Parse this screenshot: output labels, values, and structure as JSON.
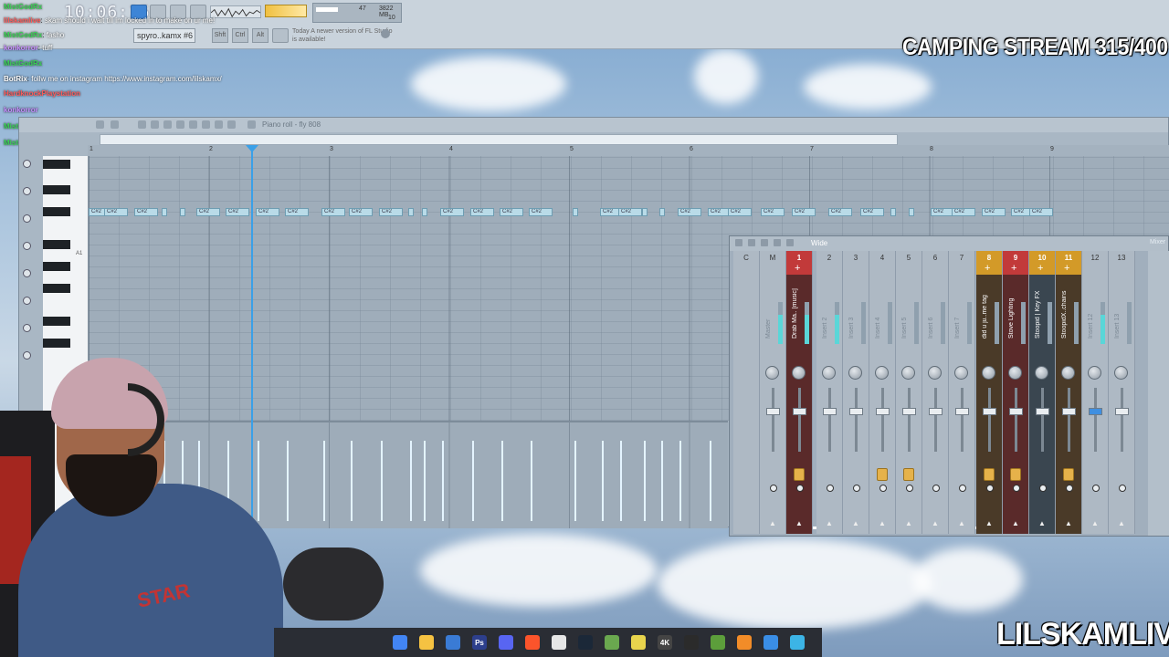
{
  "app": {
    "clock": "10:06:15",
    "cpu": {
      "v1": "47",
      "v2": "3822 MB",
      "v3": "10"
    },
    "preset": "spyro..kamx #6",
    "mode_buttons": [
      "Shft",
      "Ctrl",
      "Alt"
    ],
    "update_note": "Today  A newer version of FL Studio is available!"
  },
  "chat": [
    {
      "user": "MistGodRx",
      "message": "",
      "color": "#39d353"
    },
    {
      "user": "lilskamlive",
      "message": "skam should i wait till im locked in to make on ur me!",
      "color": "#ff5a5a"
    },
    {
      "user": "MistGodRx",
      "message": "fasho",
      "color": "#39d353"
    },
    {
      "user": "konkorror",
      "message": "tuff",
      "color": "#c68cff"
    },
    {
      "user": "MistGodRx",
      "message": "",
      "color": "#39d353"
    },
    {
      "user": "BotRix",
      "message": "follw me on instagram https://www.instagram.com/lilskamx/",
      "color": "#ffffff"
    },
    {
      "user": "HardknockPlaystation",
      "message": "",
      "color": "#ff5a5a"
    },
    {
      "user": "konkorror",
      "message": "",
      "color": "#c68cff"
    },
    {
      "user": "MistGodRx",
      "message": "",
      "color": "#39d353"
    },
    {
      "user": "MistGodRx",
      "message": "",
      "color": "#39d353"
    }
  ],
  "overlay": {
    "stream_title": "CAMPING STREAM 315/400",
    "brand": "LILSKAMLIVE",
    "hoodie_text": "STAR"
  },
  "piano_roll": {
    "title": "Piano roll - fly 808",
    "bars": [
      "1",
      "2",
      "3",
      "4",
      "5",
      "6",
      "7",
      "8",
      "9"
    ],
    "key_label": "A1",
    "note_label": "C#2",
    "note_count": 46,
    "velocity_count": 40
  },
  "mixer": {
    "title": "Wide",
    "side_label": "Mixer",
    "strips": [
      {
        "num": "C",
        "name": "",
        "kind": "plain"
      },
      {
        "num": "M",
        "name": "Master",
        "kind": "plain"
      },
      {
        "num": "1",
        "name": "Drab Ma.. [music]",
        "kind": "red"
      },
      {
        "num": "2",
        "name": "Insert 2",
        "kind": "plain"
      },
      {
        "num": "3",
        "name": "Insert 3",
        "kind": "plain"
      },
      {
        "num": "4",
        "name": "Insert 4",
        "kind": "plain"
      },
      {
        "num": "5",
        "name": "Insert 5",
        "kind": "plain"
      },
      {
        "num": "6",
        "name": "Insert 6",
        "kind": "plain"
      },
      {
        "num": "7",
        "name": "Insert 7",
        "kind": "plain"
      },
      {
        "num": "8",
        "name": "did u ju..me tag",
        "kind": "orange"
      },
      {
        "num": "9",
        "name": "Stove Lighting",
        "kind": "red"
      },
      {
        "num": "10",
        "name": "Stoopid | Key FX",
        "kind": "dark"
      },
      {
        "num": "11",
        "name": "StoopidX..chains",
        "kind": "orange"
      },
      {
        "num": "12",
        "name": "Insert 12",
        "kind": "plain"
      },
      {
        "num": "13",
        "name": "Insert 13",
        "kind": "plain"
      }
    ]
  },
  "taskbar": {
    "icons": [
      "chrome-icon",
      "folder-icon",
      "store-icon",
      "photoshop-icon",
      "discord-icon",
      "brave-icon",
      "app-icon",
      "steam-icon",
      "app-icon",
      "app-icon",
      "app-icon",
      "capcut-icon",
      "app-icon",
      "fl-studio-icon",
      "app-icon",
      "notepad-icon"
    ],
    "icon_text": {
      "photoshop": "Ps",
      "ae": "4K"
    }
  }
}
